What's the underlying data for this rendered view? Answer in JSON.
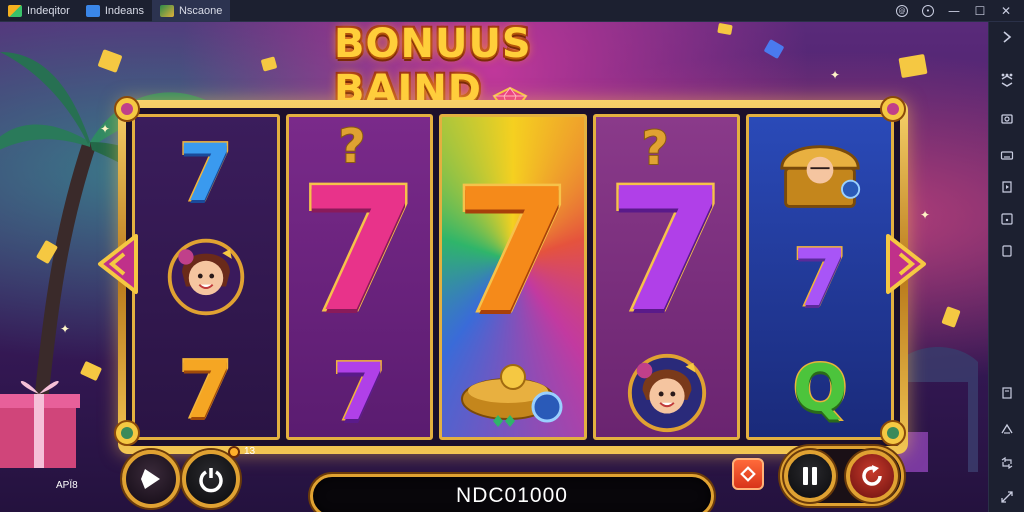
{
  "window": {
    "tabs": [
      {
        "label": "Indeqitor",
        "icon": "app-logo-icon",
        "active": false
      },
      {
        "label": "Indeans",
        "icon": "window-tab-icon",
        "active": false
      },
      {
        "label": "Nscaone",
        "icon": "game-thumbnail-icon",
        "active": true
      }
    ],
    "controls": [
      "account-icon",
      "settings-icon",
      "minimize-icon",
      "maximize-icon",
      "close-icon"
    ]
  },
  "sidebar": {
    "buttons": [
      "expand-icon",
      "sidebar-dots-icon",
      "collapse-arrows-icon",
      "screenshot-icon",
      "keyboard-icon",
      "record-icon",
      "multi-instance-icon",
      "fullscreen-icon",
      "list-icon",
      "back-icon",
      "rotate-icon",
      "shake-icon"
    ]
  },
  "game": {
    "title": "BONUUS BAIND",
    "reels": [
      [
        "seven-blue",
        "character-girl",
        "seven-gold"
      ],
      [
        "seven-pink-big",
        "seven-purple"
      ],
      [
        "seven-orange-big",
        "treasure-pot"
      ],
      [
        "seven-purple-big",
        "character-girl"
      ],
      [
        "treasure-chest",
        "seven-lilac",
        "q-green"
      ]
    ],
    "symbols": {
      "seven": "7",
      "curl": "?",
      "q": "Q"
    },
    "hud": {
      "balance": "NDC01000",
      "badge_count": "13",
      "corner_label": "APÏ8"
    }
  },
  "colors": {
    "frame_gold": "#e0a232",
    "window_chrome": "#1c2030",
    "accent_orange": "#f58a1a"
  }
}
